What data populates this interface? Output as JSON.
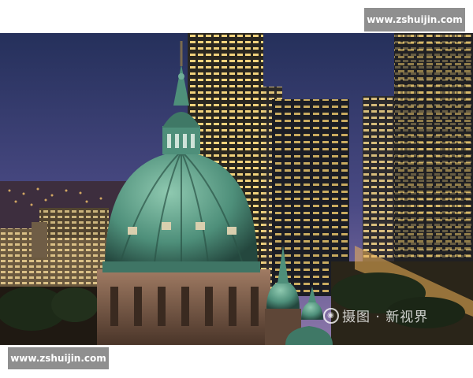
{
  "watermarks": {
    "top_site": "www.zshuijin.com",
    "bottom_site": "www.zshuijin.com",
    "stock_brand": "摄图 · 新视界"
  },
  "colors": {
    "sky_top": "#27335f",
    "sky_horizon": "#8a6fa6",
    "dome_green": "#4e8f7a",
    "window_light": "#f4d98a",
    "watermark_bg": "#8f8f8f"
  }
}
